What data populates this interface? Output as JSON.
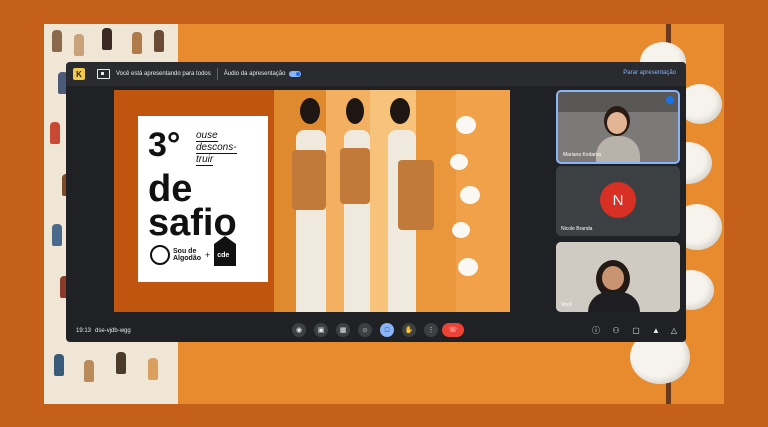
{
  "topbar": {
    "presenting_text": "Você está apresentando para todos",
    "audio_text": "Áudio da apresentação",
    "stop_text": "Parar apresentação"
  },
  "slide": {
    "number": "3°",
    "line1": "de",
    "line2": "safio",
    "tagline": [
      "ouse",
      "descons-",
      "truir"
    ],
    "brand": [
      "Sou de",
      "Algodão"
    ],
    "plus": "+",
    "cde": "cde"
  },
  "participants": [
    {
      "name": "Mariana Kodama"
    },
    {
      "name": "Nicole Branda",
      "initial": "N"
    },
    {
      "name": "Você"
    }
  ],
  "bottombar": {
    "time": "19:13",
    "meeting_code": "dse-vjdb-wgg"
  },
  "icons": [
    "logo-icon",
    "present-icon",
    "mic-icon",
    "camera-icon",
    "captions-icon",
    "emoji-icon",
    "present-screen-icon",
    "raise-hand-icon",
    "more-icon",
    "end-call-icon",
    "info-icon",
    "people-icon",
    "chat-icon",
    "activities-icon",
    "host-controls-icon"
  ],
  "colors": {
    "accent": "#8ab4f8",
    "end_call": "#ea4335",
    "meet_bg": "#202124",
    "frame": "#c5601a"
  }
}
